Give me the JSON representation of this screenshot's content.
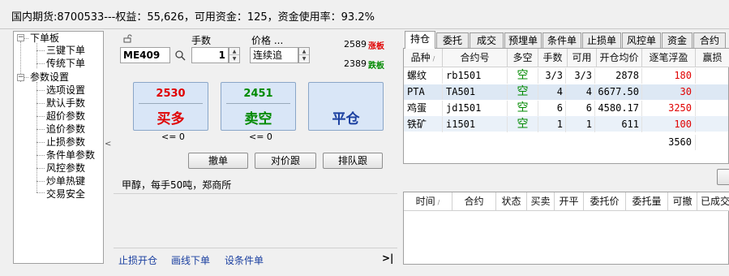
{
  "title": "国内期货:8700533---权益：55,626，可用资金：125，资金使用率：93.2%",
  "tree": {
    "root1": "下单板",
    "child1": "三键下单",
    "child2": "传统下单",
    "root2": "参数设置",
    "children2": [
      "选项设置",
      "默认手数",
      "超价参数",
      "追价参数",
      "止损参数",
      "条件单参数",
      "风控参数",
      "炒单热键",
      "交易安全"
    ]
  },
  "order": {
    "lots_label": "手数",
    "price_label": "价格 ...",
    "contract_value": "ME409",
    "lots_value": "1",
    "price_value": "连续追",
    "limit_up_price": "2589",
    "limit_up_label": "涨板",
    "limit_down_price": "2389",
    "limit_down_label": "跌板",
    "buy_price": "2530",
    "buy_label": "买多",
    "sell_price": "2451",
    "sell_label": "卖空",
    "close_label": "平仓",
    "buy_limit": "<= 0",
    "sell_limit": "<= 0",
    "cancel_label": "撤单",
    "follow_counter_label": "对价跟",
    "follow_queue_label": "排队跟",
    "info": "甲醇，每手50吨，郑商所",
    "links": [
      "止损开仓",
      "画线下单",
      "设条件单"
    ],
    "more_icon": ">|"
  },
  "tabs": [
    "持仓",
    "委托",
    "成交",
    "预埋单",
    "条件单",
    "止损单",
    "风控单",
    "资金",
    "合约"
  ],
  "positions": {
    "headers": [
      "品种",
      "合约号",
      "多空",
      "手数",
      "可用",
      "开仓均价",
      "逐笔浮盈",
      "赢损"
    ],
    "rows": [
      {
        "name": "螺纹",
        "code": "rb1501",
        "dir": "空",
        "lots": "3/3",
        "avail": "3/3",
        "price": "2878",
        "pnl": "180"
      },
      {
        "name": "PTA",
        "code": "TA501",
        "dir": "空",
        "lots": "4",
        "avail": "4",
        "price": "6677.50",
        "pnl": "30"
      },
      {
        "name": "鸡蛋",
        "code": "jd1501",
        "dir": "空",
        "lots": "6",
        "avail": "6",
        "price": "4580.17",
        "pnl": "3250"
      },
      {
        "name": "铁矿",
        "code": "i1501",
        "dir": "空",
        "lots": "1",
        "avail": "1",
        "price": "611",
        "pnl": "100"
      }
    ],
    "total_pnl": "3560"
  },
  "orders": {
    "headers": [
      "时间",
      "合约",
      "状态",
      "买卖",
      "开平",
      "委托价",
      "委托量",
      "可撤",
      "已成交"
    ]
  },
  "colors": {
    "red": "#e00000",
    "green": "#008a00",
    "link": "#1a3fa0",
    "button_bg": "#d9e6f7"
  }
}
